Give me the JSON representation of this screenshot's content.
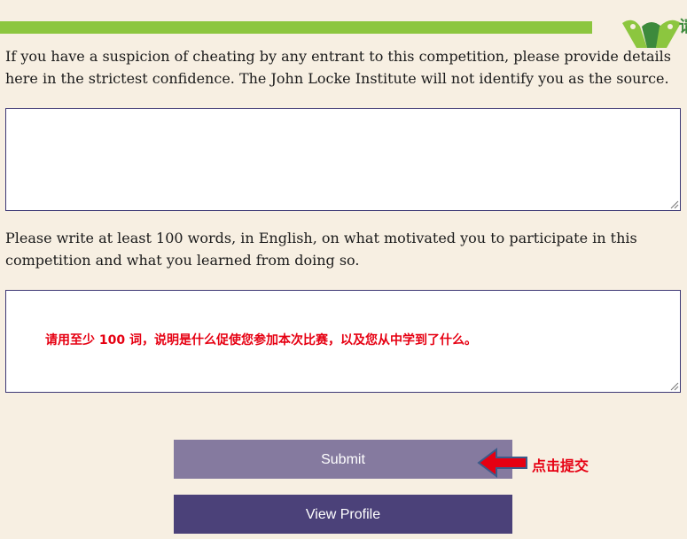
{
  "header": {
    "logo_text": "请"
  },
  "form": {
    "cheating_prompt": "If you have a suspicion of cheating by any entrant to this competition, please provide details here in the strictest confidence. The John Locke Institute will not identify you as the source.",
    "cheating_value": "",
    "motivation_prompt": "Please write at least 100 words, in English, on what motivated you to participate in this competition and what you learned from doing so.",
    "motivation_annotation": "请用至少 100 词，说明是什么促使您参加本次比赛，以及您从中学到了什么。"
  },
  "buttons": {
    "submit_label": "Submit",
    "view_profile_label": "View Profile"
  },
  "annotations": {
    "submit_hint": "点击提交"
  },
  "colors": {
    "accent_green": "#8cc63f",
    "submit_bg": "#857a9f",
    "profile_bg": "#4b4179",
    "annotation_red": "#e60012",
    "page_bg": "#f7efe2"
  },
  "icons": {
    "logo": "green-w-logo-icon",
    "arrow": "red-left-arrow-icon",
    "resize": "resize-grip-icon"
  }
}
